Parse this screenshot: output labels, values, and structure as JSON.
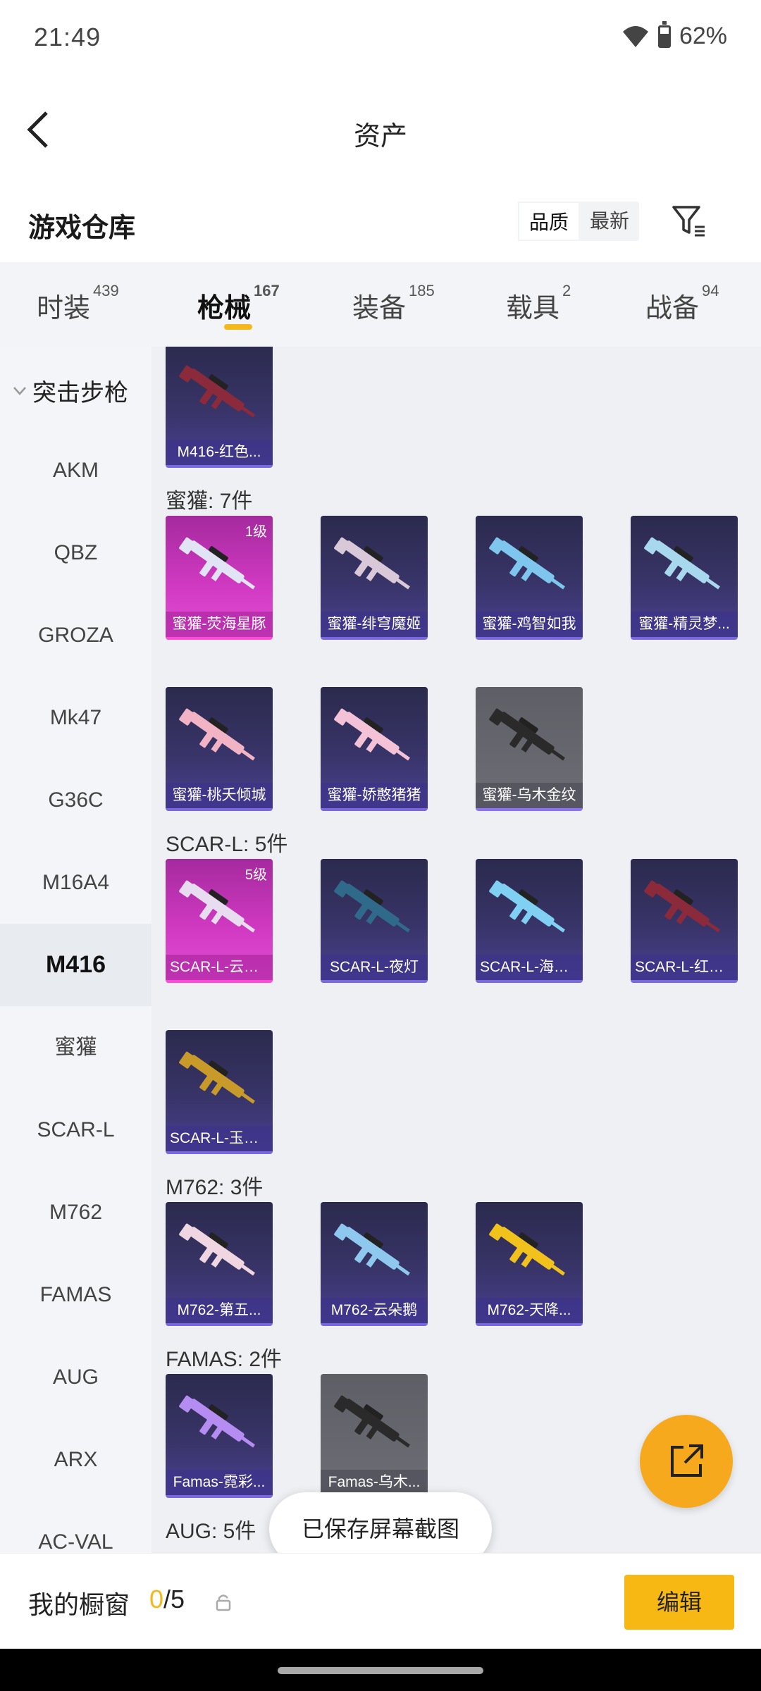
{
  "status_bar": {
    "time": "21:49",
    "battery": "62%",
    "battery_level": 0.62
  },
  "header": {
    "title": "资产",
    "back_icon": "chevron-left-icon"
  },
  "section": {
    "title": "游戏仓库",
    "sort_options": [
      "品质",
      "最新"
    ],
    "sort_active": "品质",
    "filter_icon": "filter-icon"
  },
  "tabs": [
    {
      "label": "时装",
      "count": "439"
    },
    {
      "label": "枪械",
      "count": "167",
      "active": true
    },
    {
      "label": "装备",
      "count": "185"
    },
    {
      "label": "载具",
      "count": "2"
    },
    {
      "label": "战备",
      "count": "94"
    }
  ],
  "sidebar": {
    "group": "突击步枪",
    "items": [
      "AKM",
      "QBZ",
      "GROZA",
      "Mk47",
      "G36C",
      "M16A4",
      "M416",
      "蜜獾",
      "SCAR-L",
      "M762",
      "FAMAS",
      "AUG",
      "ARX",
      "AC-VAL"
    ],
    "active": "M416"
  },
  "content": {
    "groups": [
      {
        "label": "",
        "items": [
          {
            "name": "M416-红色...",
            "style": "purple",
            "gun_color": "#8a2a3a"
          }
        ]
      },
      {
        "label": "蜜獾: 7件",
        "items": [
          {
            "name": "蜜獾-荧海星豚",
            "style": "pink",
            "level": "1级",
            "gun_color": "#e0e4f5"
          },
          {
            "name": "蜜獾-绯穹魔姬",
            "style": "purple",
            "gun_color": "#d8c8d8"
          },
          {
            "name": "蜜獾-鸡智如我",
            "style": "purple",
            "gun_color": "#7ec6ee"
          },
          {
            "name": "蜜獾-精灵梦...",
            "style": "purple",
            "gun_color": "#a8d8ee"
          },
          {
            "name": "蜜獾-桃夭倾城",
            "style": "purple",
            "gun_color": "#f2b4c4"
          },
          {
            "name": "蜜獾-娇憨猪猪",
            "style": "purple",
            "gun_color": "#f3c2d6"
          },
          {
            "name": "蜜獾-乌木金纹",
            "style": "grey",
            "gun_color": "#2a2a2a"
          }
        ]
      },
      {
        "label": "SCAR-L: 5件",
        "items": [
          {
            "name": "SCAR-L-云端...",
            "style": "pink",
            "level": "5级",
            "gun_color": "#e8dcf0"
          },
          {
            "name": "SCAR-L-夜灯",
            "style": "purple",
            "gun_color": "#2f6a8a"
          },
          {
            "name": "SCAR-L-海盐...",
            "style": "purple",
            "gun_color": "#7fd0f2"
          },
          {
            "name": "SCAR-L-红色...",
            "style": "purple",
            "gun_color": "#8a2a3a"
          },
          {
            "name": "SCAR-L-玉兔...",
            "style": "purple",
            "gun_color": "#c89a2a"
          }
        ]
      },
      {
        "label": "M762: 3件",
        "items": [
          {
            "name": "M762-第五...",
            "style": "purple",
            "gun_color": "#efd6e0"
          },
          {
            "name": "M762-云朵鹅",
            "style": "purple",
            "gun_color": "#8ec8ee"
          },
          {
            "name": "M762-天降...",
            "style": "purple",
            "gun_color": "#f2c21c"
          }
        ]
      },
      {
        "label": "FAMAS: 2件",
        "items": [
          {
            "name": "Famas-霓彩...",
            "style": "purple",
            "gun_color": "#b58cf2"
          },
          {
            "name": "Famas-乌木...",
            "style": "grey",
            "gun_color": "#2a2a2a"
          }
        ]
      },
      {
        "label": "AUG: 5件",
        "items": []
      }
    ]
  },
  "toast": "已保存屏幕截图",
  "fab_icon": "share-external-icon",
  "bottom_bar": {
    "label": "我的橱窗",
    "current": "0",
    "total": "/5",
    "lock_icon": "lock-icon",
    "edit_label": "编辑"
  },
  "colors": {
    "accent": "#f5b81c",
    "fab": "#f6a91d"
  }
}
